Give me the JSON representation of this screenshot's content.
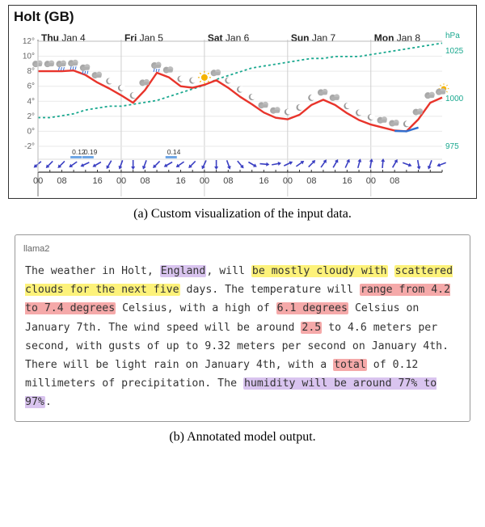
{
  "chart_title": "Holt (GB)",
  "caption_a": "(a) Custom visualization of the input data.",
  "caption_b": "(b) Annotated model output.",
  "model_tag": "llama2",
  "output_text": [
    {
      "t": "The weather in Holt, "
    },
    {
      "t": "England",
      "c": "hl-p"
    },
    {
      "t": ", will "
    },
    {
      "t": "be mostly cloudy with",
      "c": "hl-y"
    },
    {
      "t": " "
    },
    {
      "t": "scattered clouds for the next five",
      "c": "hl-y"
    },
    {
      "t": " days. The temperature will "
    },
    {
      "t": "range from 4.2 to 7.4 degrees",
      "c": "hl-r"
    },
    {
      "t": " Celsius, with a high of "
    },
    {
      "t": "6.1 degrees",
      "c": "hl-r"
    },
    {
      "t": " Celsius on January 7th. The wind speed will be around "
    },
    {
      "t": "2.5",
      "c": "hl-r"
    },
    {
      "t": " to 4.6 meters per second, with gusts of up to 9.32 meters per second on January 4th. There will be light rain on January 4th, with a "
    },
    {
      "t": "total",
      "c": "hl-r"
    },
    {
      "t": " of 0.12 millimeters of precipitation. The "
    },
    {
      "t": "humidity will be around 77% to 97%",
      "c": "hl-p"
    },
    {
      "t": "."
    }
  ],
  "chart_data": {
    "type": "line",
    "location": "Holt (GB)",
    "xlabel": "",
    "ylabel_left": "°C",
    "ylabel_right": "hPa",
    "y_left_range": [
      -2,
      12
    ],
    "y_left_ticks": [
      -2,
      0,
      2,
      4,
      6,
      8,
      10,
      12
    ],
    "y_right_range": [
      975,
      1030
    ],
    "y_right_ticks": [
      975,
      1000,
      1025
    ],
    "day_headers": [
      {
        "dow": "Thu",
        "date": "Jan 4"
      },
      {
        "dow": "Fri",
        "date": "Jan 5"
      },
      {
        "dow": "Sat",
        "date": "Jan 6"
      },
      {
        "dow": "Sun",
        "date": "Jan 7"
      },
      {
        "dow": "Mon",
        "date": "Jan 8"
      }
    ],
    "x_hours": [
      "00",
      "08",
      "16",
      "00",
      "08",
      "16",
      "00",
      "08",
      "16",
      "00",
      "08",
      "16",
      "00",
      "08"
    ],
    "series": [
      {
        "name": "temperature_c",
        "color": "#e8342b",
        "values": [
          8.0,
          8.0,
          8.0,
          8.1,
          7.5,
          6.5,
          5.7,
          4.8,
          3.8,
          5.5,
          7.8,
          7.2,
          6.0,
          5.8,
          6.2,
          6.8,
          5.8,
          4.6,
          3.6,
          2.5,
          1.8,
          1.6,
          2.2,
          3.5,
          4.2,
          3.5,
          2.4,
          1.5,
          0.9,
          0.5,
          0.1,
          0.0,
          1.6,
          3.8,
          4.5
        ]
      },
      {
        "name": "dew_or_freeze_c",
        "color": "#2f6fd0",
        "values": [
          null,
          null,
          null,
          null,
          null,
          null,
          null,
          null,
          null,
          null,
          null,
          null,
          null,
          null,
          null,
          null,
          null,
          null,
          null,
          null,
          null,
          null,
          null,
          null,
          null,
          null,
          null,
          null,
          null,
          null,
          0.05,
          0.0,
          0.5,
          null,
          null
        ]
      },
      {
        "name": "pressure_hpa",
        "color": "#1aa88f",
        "dash": true,
        "values": [
          990,
          990,
          991,
          992,
          994,
          995,
          996,
          996,
          997,
          998,
          999,
          1001,
          1003,
          1005,
          1007,
          1010,
          1012,
          1014,
          1016,
          1017,
          1018,
          1019,
          1020,
          1021,
          1021,
          1022,
          1022,
          1022,
          1023,
          1024,
          1025,
          1026,
          1027,
          1028,
          1029
        ]
      }
    ],
    "weather_icons": [
      "cloud",
      "cloud",
      "rain",
      "rain",
      "rain",
      "cloud",
      "night",
      "night",
      "night",
      "cloud",
      "rain",
      "cloud",
      "night",
      "night",
      "sun",
      "cloud",
      "night",
      "night",
      "night",
      "cloud",
      "cloud",
      "night",
      "night",
      "night",
      "cloud",
      "cloud",
      "night",
      "night",
      "night",
      "cloud",
      "cloud",
      "night",
      "cloud",
      "cloud",
      "partly-sunny"
    ],
    "precip_labels": [
      {
        "at": 3,
        "val": "0.12"
      },
      {
        "at": 4,
        "val": "0.19"
      },
      {
        "at": 11,
        "val": "0.14"
      }
    ],
    "wind_arrows_deg": [
      230,
      225,
      225,
      235,
      245,
      240,
      210,
      200,
      180,
      200,
      225,
      240,
      235,
      225,
      205,
      180,
      160,
      140,
      120,
      95,
      80,
      65,
      55,
      45,
      35,
      30,
      25,
      15,
      10,
      5,
      30,
      110,
      170,
      200,
      250
    ]
  }
}
